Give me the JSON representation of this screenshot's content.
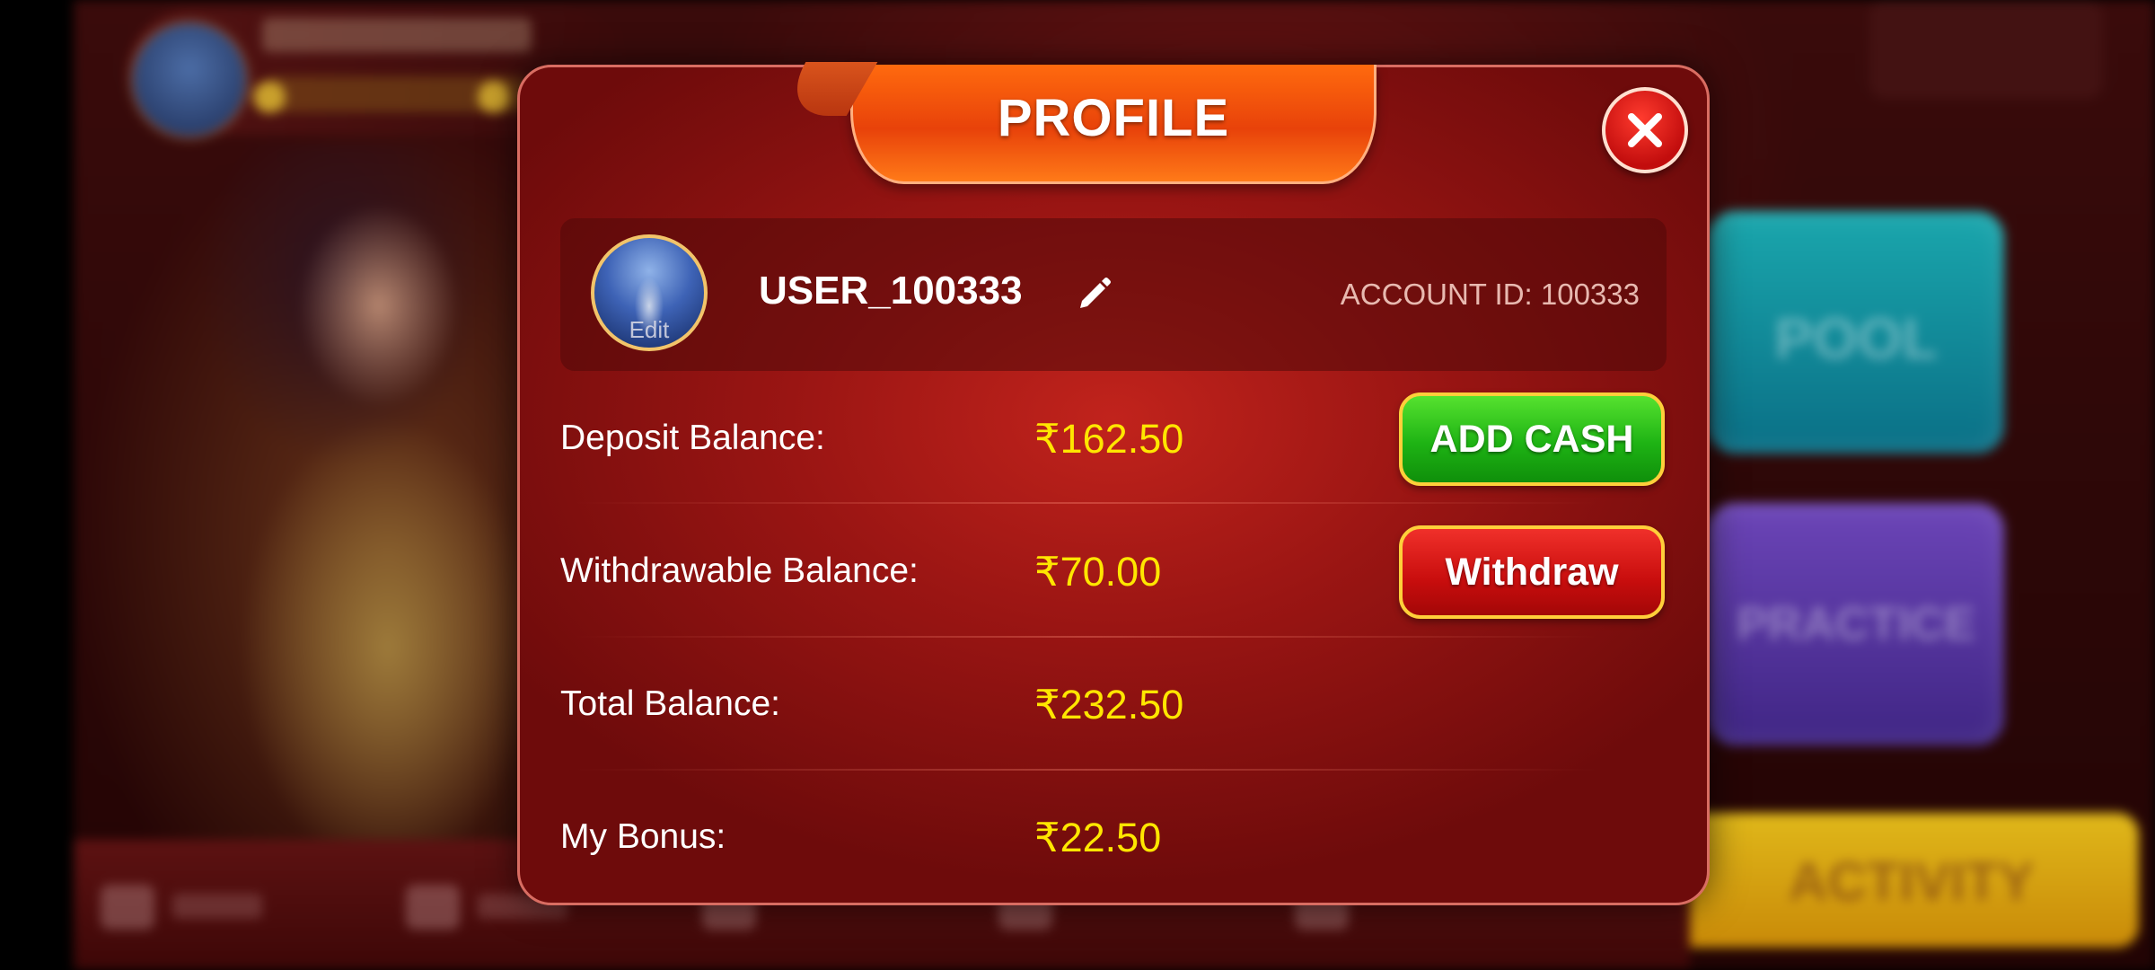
{
  "background": {
    "pool_label": "POOL",
    "practice_label": "PRACTICE",
    "activity_label": "ACTIVITY"
  },
  "modal": {
    "title": "PROFILE",
    "close_icon": "close-icon",
    "profile": {
      "avatar_edit_label": "Edit",
      "username": "USER_100333",
      "edit_name_icon": "pencil-icon",
      "account_id": "ACCOUNT ID: 100333"
    },
    "rows": [
      {
        "label": "Deposit Balance:",
        "value": "₹162.50"
      },
      {
        "label": "Withdrawable Balance:",
        "value": "₹70.00"
      },
      {
        "label": "Total Balance:",
        "value": "₹232.50"
      },
      {
        "label": "My Bonus:",
        "value": "₹22.50"
      }
    ],
    "buttons": {
      "add_cash": "ADD CASH",
      "withdraw": "Withdraw"
    }
  },
  "colors": {
    "accent_value": "#ffe600",
    "add_cash_green": "#1eb314",
    "withdraw_red": "#c80d0d",
    "title_orange": "#ff6a0e"
  }
}
